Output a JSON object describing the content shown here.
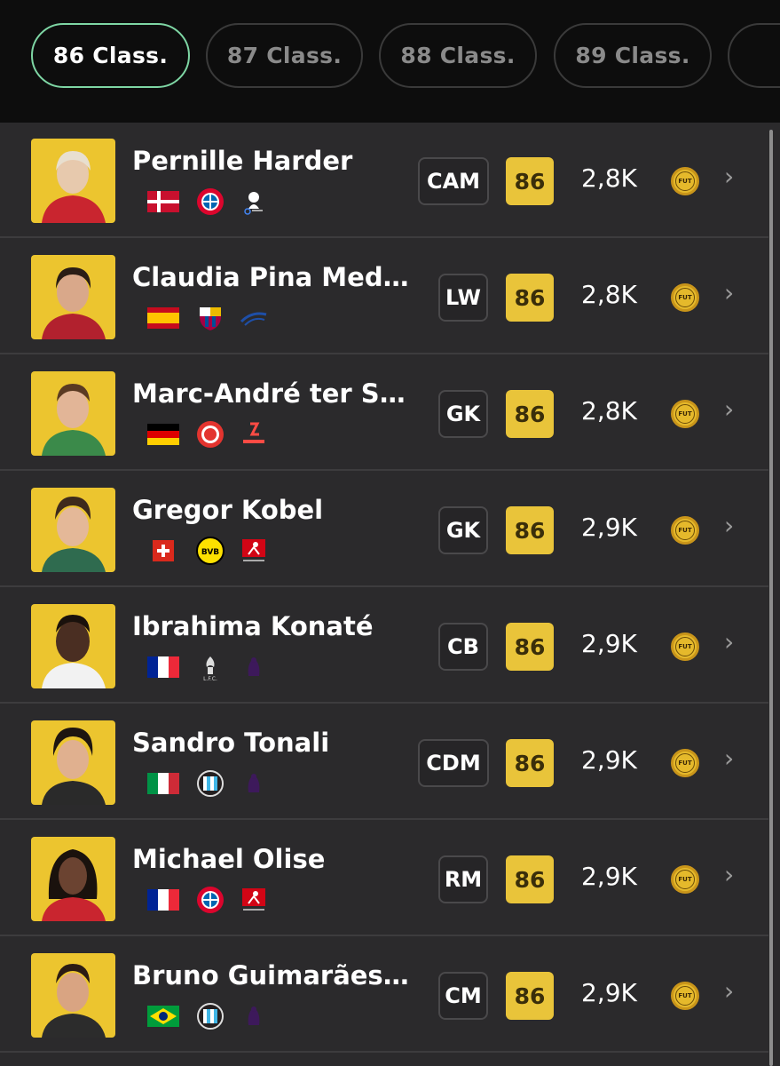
{
  "tabs": [
    {
      "label": "86 Class.",
      "active": true
    },
    {
      "label": "87 Class.",
      "active": false
    },
    {
      "label": "88 Class.",
      "active": false
    },
    {
      "label": "89 Class.",
      "active": false
    }
  ],
  "players": [
    {
      "name": "Pernille Harder",
      "position": "CAM",
      "rating": "86",
      "price": "2,8K",
      "flag": "denmark",
      "club": "fc-bayern-icon",
      "league": "google-pixel-frauen-bundesliga-icon"
    },
    {
      "name": "Claudia Pina Medi…",
      "position": "LW",
      "rating": "86",
      "price": "2,8K",
      "flag": "spain",
      "club": "fc-barcelona-icon",
      "league": "liga-f-icon"
    },
    {
      "name": "Marc-André ter St…",
      "position": "GK",
      "rating": "86",
      "price": "2,8K",
      "flag": "germany",
      "club": "girona-fc-icon",
      "league": "laliga-icon"
    },
    {
      "name": "Gregor Kobel",
      "position": "GK",
      "rating": "86",
      "price": "2,9K",
      "flag": "switzerland",
      "club": "borussia-dortmund-icon",
      "league": "bundesliga-icon"
    },
    {
      "name": "Ibrahima Konaté",
      "position": "CB",
      "rating": "86",
      "price": "2,9K",
      "flag": "france",
      "club": "liverpool-fc-icon",
      "league": "premier-league-icon"
    },
    {
      "name": "Sandro Tonali",
      "position": "CDM",
      "rating": "86",
      "price": "2,9K",
      "flag": "italy",
      "club": "newcastle-united-icon",
      "league": "premier-league-icon"
    },
    {
      "name": "Michael Olise",
      "position": "RM",
      "rating": "86",
      "price": "2,9K",
      "flag": "france",
      "club": "fc-bayern-icon",
      "league": "bundesliga-icon"
    },
    {
      "name": "Bruno Guimarães…",
      "position": "CM",
      "rating": "86",
      "price": "2,9K",
      "flag": "brazil",
      "club": "newcastle-united-icon",
      "league": "premier-league-icon"
    }
  ],
  "coin_label": "FUT",
  "colors": {
    "rating_bg": "#e9c43a",
    "active_tab_border": "#7ed6a4",
    "avatar_bg": "#ecc52f",
    "row_bg": "#2b2a2c"
  }
}
